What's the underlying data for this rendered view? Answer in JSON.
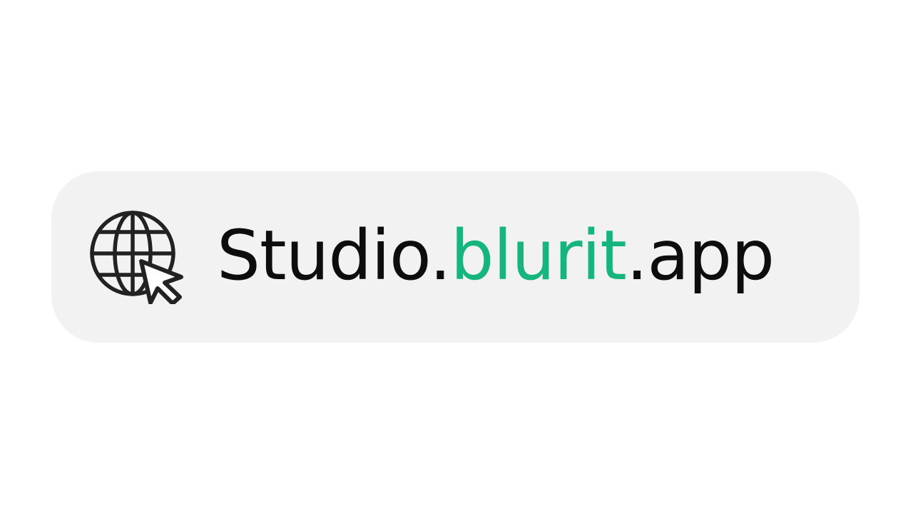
{
  "address_bar": {
    "icon": "globe-cursor-icon",
    "url": {
      "part1": "Studio.",
      "part2": "blurit",
      "part3": ".app"
    },
    "colors": {
      "text": "#0d0d0d",
      "accent": "#16b57e",
      "background": "#f2f2f2",
      "icon": "#222222"
    }
  }
}
